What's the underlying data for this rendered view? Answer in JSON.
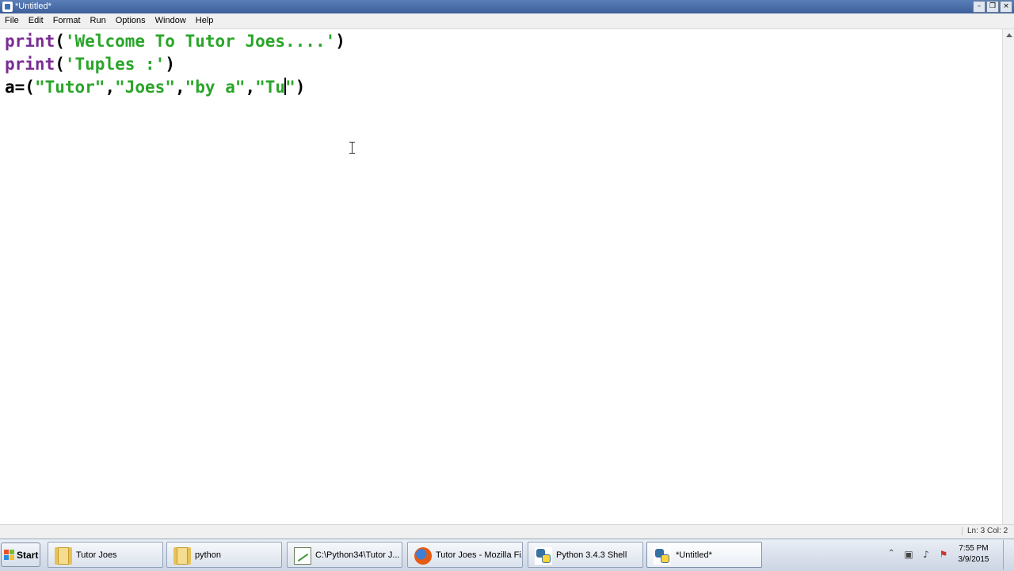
{
  "window": {
    "title": "*Untitled*"
  },
  "menu": [
    "File",
    "Edit",
    "Format",
    "Run",
    "Options",
    "Window",
    "Help"
  ],
  "code": {
    "line1": {
      "kw": "print",
      "open": "(",
      "str": "'Welcome To Tutor Joes....'",
      "close": ")"
    },
    "line2": {
      "kw": "print",
      "open": "(",
      "str": "'Tuples :'",
      "close": ")"
    },
    "line3": {
      "prefix": "a=(",
      "s1": "\"Tutor\"",
      "c1": ",",
      "s2": "\"Joes\"",
      "c2": ",",
      "s3": "\"by a\"",
      "c3": ",",
      "s4a": "\"Tu",
      "s4b": "\"",
      "close": ")"
    }
  },
  "status": {
    "position": "Ln: 3 Col: 2"
  },
  "taskbar": {
    "start": "Start",
    "tasks": [
      {
        "label": "Tutor Joes",
        "icon": "folder-icon"
      },
      {
        "label": "python",
        "icon": "folder-icon"
      },
      {
        "label": "C:\\Python34\\Tutor J...",
        "icon": "notepad-icon"
      },
      {
        "label": "Tutor Joes - Mozilla Fi...",
        "icon": "firefox-icon"
      },
      {
        "label": "Python 3.4.3 Shell",
        "icon": "python-icon"
      },
      {
        "label": "*Untitled*",
        "icon": "python-icon"
      }
    ],
    "clock": {
      "time": "7:55 PM",
      "date": "3/9/2015"
    }
  },
  "colors": {
    "keyword": "#7a2c94",
    "string": "#2aa52a",
    "titlebar": "#3d5f99"
  }
}
